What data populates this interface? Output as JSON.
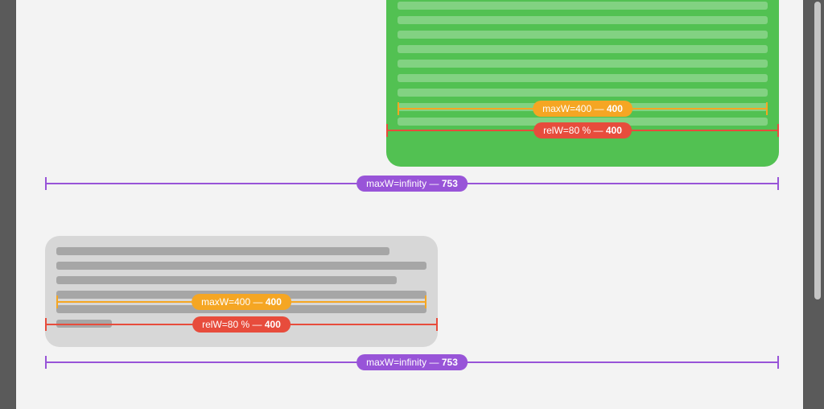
{
  "bubbles": {
    "green": {
      "measures": {
        "maxw": {
          "label": "maxW=400",
          "value": "400"
        },
        "relw": {
          "label": "relW=80 %",
          "value": "400"
        }
      }
    },
    "gray": {
      "measures": {
        "maxw": {
          "label": "maxW=400",
          "value": "400"
        },
        "relw": {
          "label": "relW=80 %",
          "value": "400"
        }
      }
    }
  },
  "outer": {
    "green": {
      "label": "maxW=infinity",
      "value": "753"
    },
    "gray": {
      "label": "maxW=infinity",
      "value": "753"
    }
  }
}
